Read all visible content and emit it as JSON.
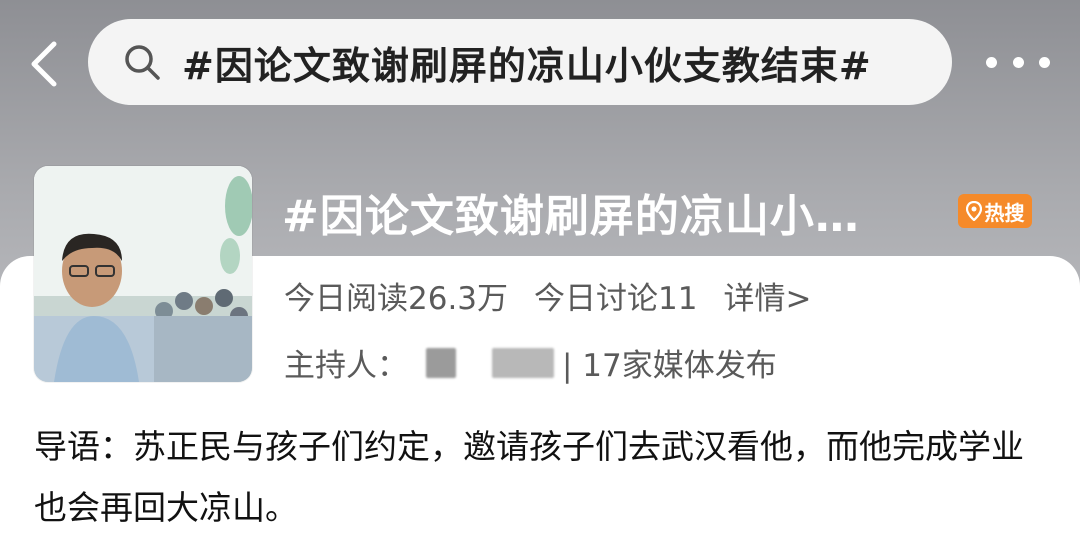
{
  "header": {
    "search_query": "#因论文致谢刷屏的凉山小伙支教结束#"
  },
  "topic": {
    "title": "#因论文致谢刷屏的凉山小…",
    "badge": "热搜",
    "reads": "今日阅读26.3万",
    "discussions": "今日讨论11",
    "details_link": "详情>",
    "host_label": "主持人：",
    "media_count": "| 17家媒体发布",
    "intro": "导语：苏正民与孩子们约定，邀请孩子们去武汉看他，而他完成学业也会再回大凉山。"
  },
  "colors": {
    "badge": "#f58a2a",
    "meta_text": "#5a5a5a"
  }
}
